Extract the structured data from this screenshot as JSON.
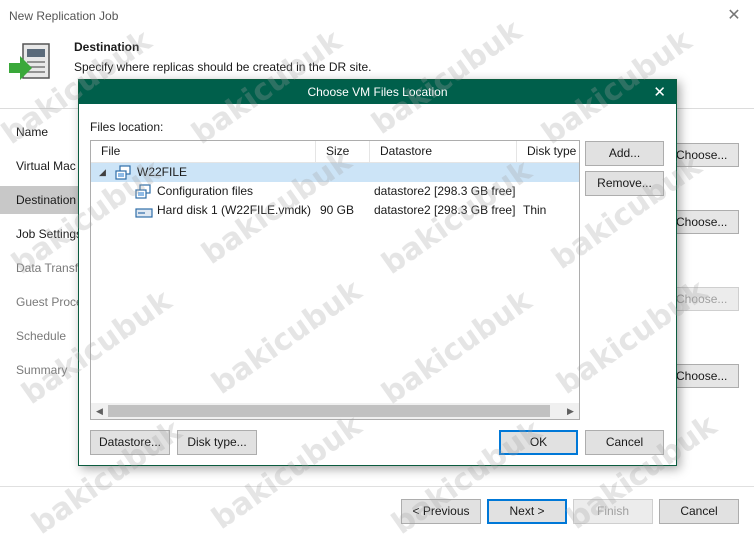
{
  "window": {
    "title": "New Replication Job",
    "close_glyph": "✕"
  },
  "header": {
    "title": "Destination",
    "subtitle": "Specify where replicas should be created in the DR site."
  },
  "nav": {
    "items": [
      {
        "label": "Name",
        "state": "done"
      },
      {
        "label": "Virtual Mac",
        "state": "done"
      },
      {
        "label": "Destination",
        "state": "active"
      },
      {
        "label": "Job Settings",
        "state": "done"
      },
      {
        "label": "Data Transfe",
        "state": "future"
      },
      {
        "label": "Guest Proce",
        "state": "future"
      },
      {
        "label": "Schedule",
        "state": "future"
      },
      {
        "label": "Summary",
        "state": "future"
      }
    ]
  },
  "background_buttons": [
    {
      "label": "Choose...",
      "enabled": true
    },
    {
      "label": "Choose...",
      "enabled": true
    },
    {
      "label": "Choose...",
      "enabled": false
    },
    {
      "label": "Choose...",
      "enabled": true
    }
  ],
  "footer": {
    "previous": "< Previous",
    "next": "Next >",
    "finish": "Finish",
    "cancel": "Cancel"
  },
  "dialog": {
    "title": "Choose VM Files Location",
    "close_glyph": "✕",
    "files_label": "Files location:",
    "columns": [
      "File",
      "Size",
      "Datastore",
      "Disk type"
    ],
    "rows": [
      {
        "file": "W22FILE",
        "size": "",
        "datastore": "",
        "disk_type": "",
        "icon": "vm-icon",
        "level": 0,
        "selected": true,
        "expander": "◢"
      },
      {
        "file": "Configuration files",
        "size": "",
        "datastore": "datastore2 [298.3 GB free]",
        "disk_type": "",
        "icon": "config-files-icon",
        "level": 1,
        "selected": false,
        "expander": ""
      },
      {
        "file": "Hard disk 1 (W22FILE.vmdk)",
        "size": "90 GB",
        "datastore": "datastore2 [298.3 GB free]",
        "disk_type": "Thin",
        "icon": "hard-disk-icon",
        "level": 1,
        "selected": false,
        "expander": ""
      }
    ],
    "side_buttons": {
      "add": "Add...",
      "remove": "Remove..."
    },
    "bottom_buttons": {
      "datastore": "Datastore...",
      "disk_type": "Disk type...",
      "ok": "OK",
      "cancel": "Cancel"
    },
    "scroll_left": "◀",
    "scroll_right": "▶"
  },
  "watermark": "bakicubuk",
  "colors": {
    "dialog_title_bg": "#005f4b",
    "selection": "#cce4f7",
    "accent_border": "#0078d7",
    "header_arrow": "#3aa83a"
  }
}
